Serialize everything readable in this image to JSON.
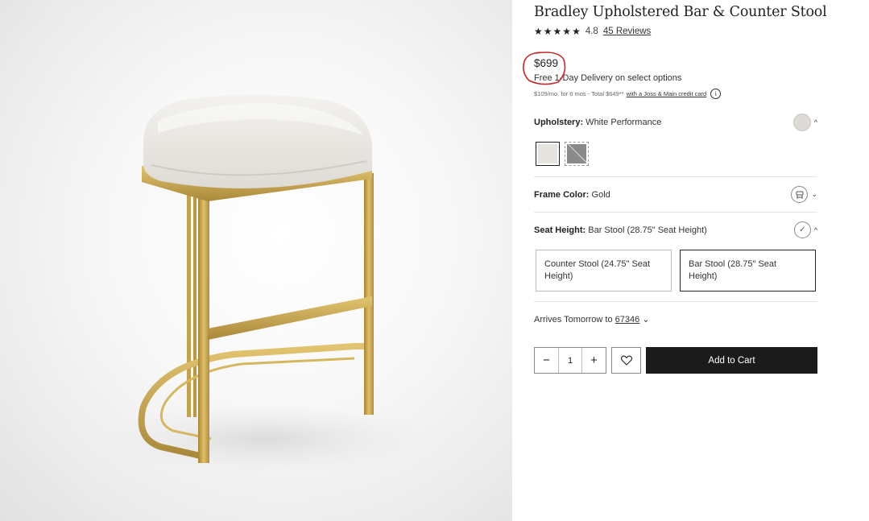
{
  "product": {
    "title": "Bradley Upholstered Bar & Counter Stool",
    "rating_value": "4.8",
    "reviews_label": "45 Reviews",
    "stars": [
      "★",
      "★",
      "★",
      "★",
      "★"
    ],
    "price": "$699",
    "delivery": "Free 1-Day Delivery on select options",
    "finance_text": "$109/mo. for 6 mos - Total $649**",
    "finance_link": "with a Joss & Main credit card",
    "info_icon": "i"
  },
  "options": {
    "upholstery": {
      "label": "Upholstery:",
      "value": " White Performance",
      "icon": "swatch-circle",
      "swatches": [
        {
          "name": "White Performance",
          "color": "#e6e4df",
          "selected": true
        },
        {
          "name": "Gray",
          "color": "#8a8a8a",
          "selected": false
        }
      ]
    },
    "frame_color": {
      "label": "Frame Color:",
      "value": " Gold",
      "icon": "stool-icon"
    },
    "seat_height": {
      "label": "Seat Height:",
      "value": " Bar Stool (28.75\" Seat Height)",
      "icon": "check-circle-icon",
      "choices": [
        {
          "label": "Counter Stool (24.75\" Seat Height)",
          "selected": false
        },
        {
          "label": "Bar Stool (28.75\" Seat Height)",
          "selected": true
        }
      ]
    }
  },
  "shipping": {
    "arrives_text": "Arrives Tomorrow to ",
    "zip": "67346",
    "chevron": "⌄"
  },
  "purchase": {
    "minus": "−",
    "quantity": "1",
    "plus": "+",
    "wishlist_icon": "heart-icon",
    "add_to_cart": "Add to Cart"
  },
  "annotation": {
    "color": "#c62828"
  },
  "frame_gold": "#c9a64a"
}
